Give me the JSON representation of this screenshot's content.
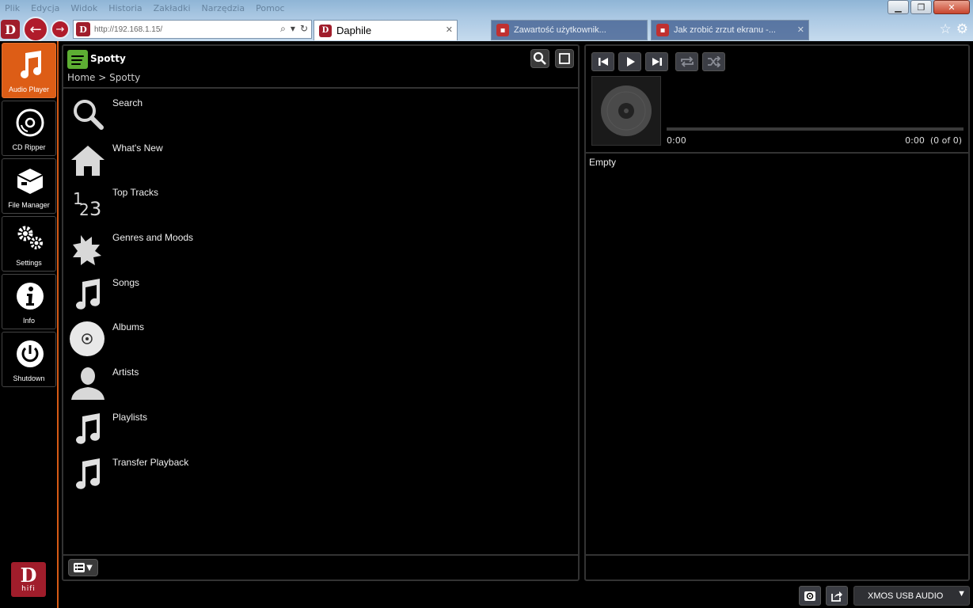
{
  "browser": {
    "menu": [
      "Plik",
      "Edycja",
      "Widok",
      "Historia",
      "Zakładki",
      "Narzędzia",
      "Pomoc"
    ],
    "url": "http://192.168.1.15/",
    "active_tab": "Daphile",
    "inactive_tabs": [
      "Zawartość użytkownik...",
      "Jak zrobić zrzut ekranu -..."
    ],
    "tab_close": "✕"
  },
  "leftnav": {
    "items": [
      {
        "label": "Audio Player",
        "icon": "music-note-icon",
        "active": true
      },
      {
        "label": "CD Ripper",
        "icon": "disc-icon",
        "active": false
      },
      {
        "label": "File Manager",
        "icon": "box-icon",
        "active": false
      },
      {
        "label": "Settings",
        "icon": "gears-icon",
        "active": false
      },
      {
        "label": "Info",
        "icon": "info-icon",
        "active": false
      },
      {
        "label": "Shutdown",
        "icon": "power-icon",
        "active": false
      }
    ],
    "brand": {
      "letter": "D",
      "text": "hifi"
    }
  },
  "browse": {
    "title": "Spotty",
    "breadcrumb": "Home > Spotty",
    "items": [
      {
        "label": "Search",
        "icon": "search-icon"
      },
      {
        "label": "What's New",
        "icon": "home-icon"
      },
      {
        "label": "Top Tracks",
        "icon": "numbers-icon"
      },
      {
        "label": "Genres and Moods",
        "icon": "puzzle-icon"
      },
      {
        "label": "Songs",
        "icon": "music-note-icon"
      },
      {
        "label": "Albums",
        "icon": "cd-icon"
      },
      {
        "label": "Artists",
        "icon": "person-icon"
      },
      {
        "label": "Playlists",
        "icon": "music-note-icon"
      },
      {
        "label": "Transfer Playback",
        "icon": "music-note-icon"
      }
    ]
  },
  "player": {
    "elapsed": "0:00",
    "total": "0:00",
    "count": "(0 of 0)",
    "progress": 0,
    "queue_status": "Empty"
  },
  "device": {
    "selected": "XMOS USB AUDIO"
  },
  "colors": {
    "accent": "#dd5d16",
    "brand": "#a01d2b",
    "spotify": "#5dae33"
  }
}
